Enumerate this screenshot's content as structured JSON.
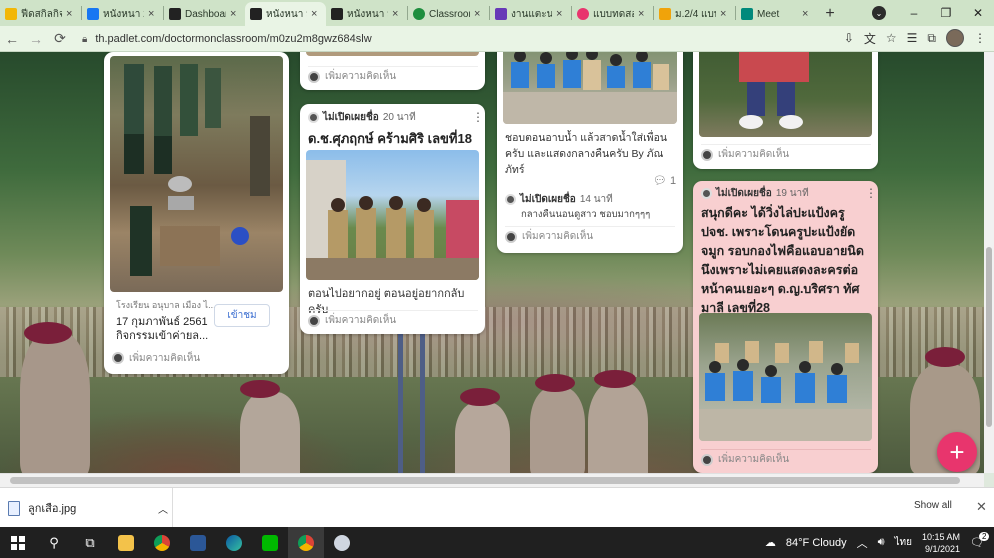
{
  "browser": {
    "tabs": [
      {
        "title": "ฟีดสกิลกิจกรร",
        "favicon_color": "#f2b705",
        "active": false
      },
      {
        "title": "หนังหนา 2",
        "favicon_color": "#1877f2",
        "active": false
      },
      {
        "title": "Dashboard",
        "favicon_color": "#222222",
        "active": false
      },
      {
        "title": "หนังหนา ม",
        "favicon_color": "#222222",
        "active": true
      },
      {
        "title": "หนังหนา ม",
        "favicon_color": "#222222",
        "active": false
      },
      {
        "title": "Classroom",
        "favicon_color": "#1e8e3e",
        "active": false
      },
      {
        "title": "งานแตะน",
        "favicon_color": "#673ab7",
        "active": false
      },
      {
        "title": "แบบทดสอ",
        "favicon_color": "#e8356d",
        "active": false
      },
      {
        "title": "ม.2/4 แบบ",
        "favicon_color": "#f0a30a",
        "active": false
      },
      {
        "title": "Meet",
        "favicon_color": "#00897b",
        "active": false
      }
    ],
    "new_tab": "+",
    "window_controls": {
      "minimize": "–",
      "restore": "❐",
      "close": "✕"
    },
    "url": "th.padlet.com/doctormonclassroom/m0zu2m8gwz684slw"
  },
  "padlet": {
    "cards": {
      "c1_top": {
        "comment": "เพิ่มความคิดเห็น"
      },
      "c1": {
        "link_site": "โรงเรียน อนุบาล เมือง ไ...",
        "link_title": "17 กุมภาพันธ์ 2561 กิจกรรมเข้าค่ายล...",
        "visit": "เข้าชม",
        "comment": "เพิ่มความคิดเห็น"
      },
      "c2_top": {
        "comment": "เพิ่มความคิดเห็น"
      },
      "c2": {
        "author": "ไม่เปิดเผยชื่อ",
        "time": "20 นาที",
        "title": "ด.ช.ศุภฤกษ์ คร้ามศิริ เลขที่18",
        "body": "ตอนไปอยากอยู่ ตอนอยู่อยากกลับครับ",
        "comment": "เพิ่มความคิดเห็น"
      },
      "c3": {
        "body": "ชอบตอนอาบน้ำ แล้วสาดน้ำใส่เพื่อนครับ และแสดงกลางคืนครับ By ภัณภัทร์",
        "comment_count": "1",
        "reply_author": "ไม่เปิดเผยชื่อ",
        "reply_time": "14 นาที",
        "reply_text": "กลางคืนนอนดูสาว ชอบมากๆๆๆ",
        "comment": "เพิ่มความคิดเห็น"
      },
      "c4_top": {
        "comment": "เพิ่มความคิดเห็น"
      },
      "c4": {
        "author": "ไม่เปิดเผยชื่อ",
        "time": "19 นาที",
        "title": "สนุกดีคะ ได้วิ่งไล่ปะแป้งครู ปจช. เพราะโดนครูปะแป้งยัดจมูก รอบกองไฟคือแอบอายนิดนึงเพราะไม่เคยแสดงละครต่อหน้าคนเยอะๆ ด.ญ.บริศรา ทัศมาลี เลขที่28",
        "comment": "เพิ่มความคิดเห็น"
      }
    },
    "add_button": "+"
  },
  "downloads": {
    "file_name": "ลูกเสือ.jpg",
    "show_all": "Show all",
    "close": "✕"
  },
  "taskbar": {
    "weather": "84°F  Cloudy",
    "time": "10:15 AM",
    "date": "9/1/2021",
    "notifications": "2"
  }
}
